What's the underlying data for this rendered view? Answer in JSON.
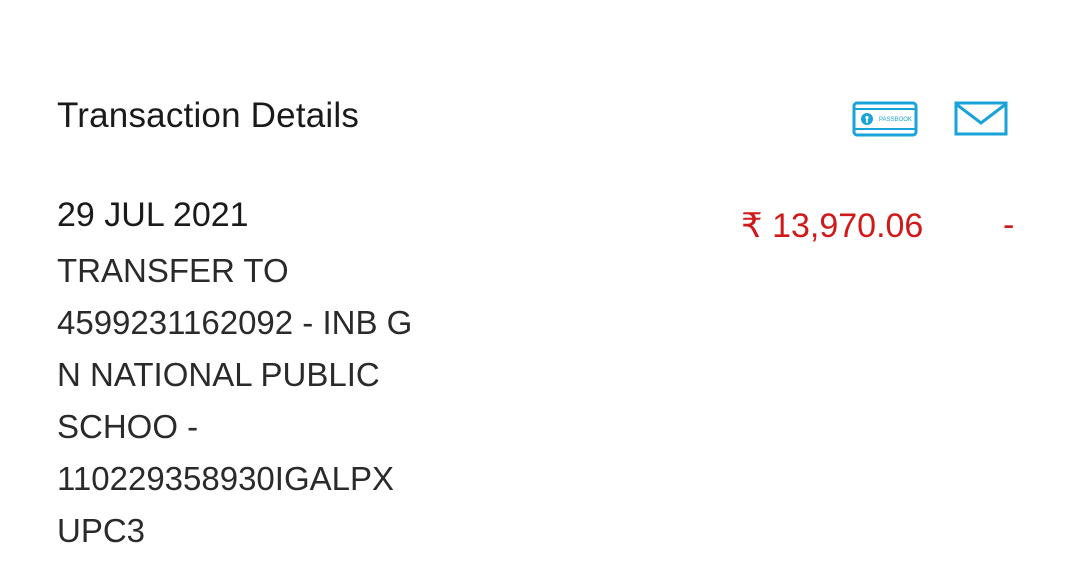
{
  "header": {
    "title": "Transaction Details",
    "passbook_icon": "passbook-icon",
    "passbook_label": "PASSBOOK",
    "mail_icon": "mail-icon"
  },
  "transaction": {
    "date": "29 JUL 2021",
    "description": "TRANSFER TO\n4599231162092 - INB G\nN NATIONAL PUBLIC\nSCHOO -\n110229358930IGALPX\nUPC3",
    "amount": "₹ 13,970.06",
    "credit": "-"
  },
  "colors": {
    "text": "#1a1a1a",
    "debit_red": "#d0191b",
    "icon_blue": "#1aa3d9"
  }
}
